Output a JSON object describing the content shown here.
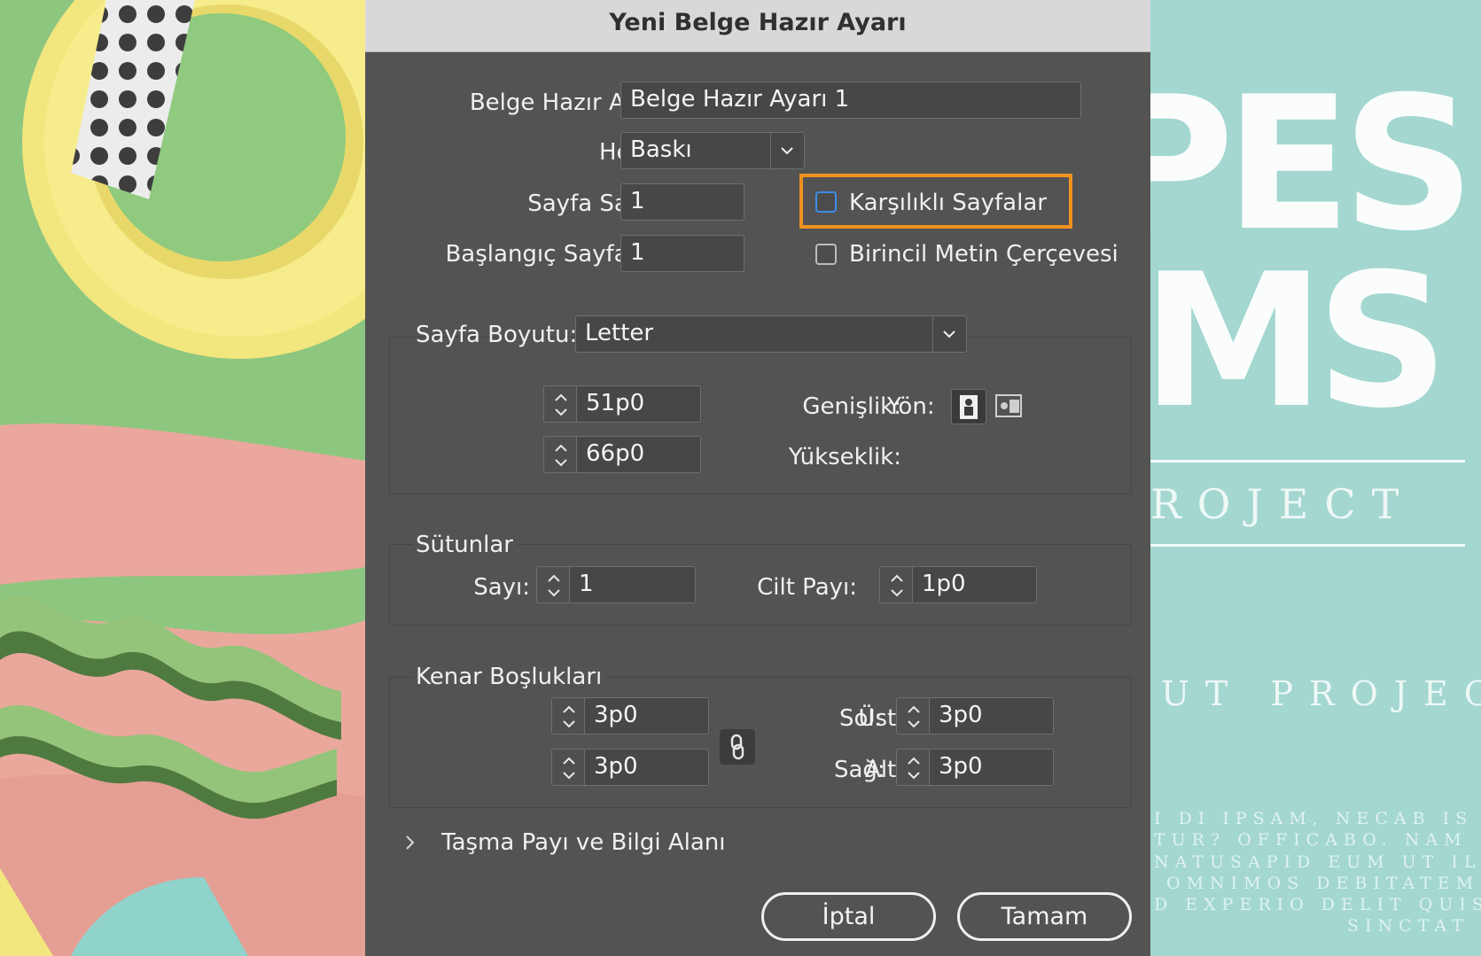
{
  "dialog": {
    "title": "Yeni Belge Hazır Ayarı",
    "preset": {
      "label": "Belge Hazır Ayarı:",
      "value": "Belge Hazır Ayarı 1"
    },
    "intent": {
      "label": "Hedef:",
      "value": "Baskı"
    },
    "page_count": {
      "label": "Sayfa Sayısı:",
      "value": "1"
    },
    "start_page": {
      "label": "Başlangıç Sayfa No:",
      "value": "1"
    },
    "facing_pages": {
      "label": "Karşılıklı Sayfalar",
      "checked": false,
      "highlighted": true
    },
    "primary_text_frame": {
      "label": "Birincil Metin Çerçevesi",
      "checked": false
    },
    "page_size": {
      "label": "Sayfa Boyutu:",
      "value": "Letter",
      "width": {
        "label": "Genişlik:",
        "value": "51p0"
      },
      "height": {
        "label": "Yükseklik:",
        "value": "66p0"
      },
      "orientation": {
        "label": "Yön:",
        "selected": "portrait",
        "options": [
          "portrait-icon",
          "landscape-icon"
        ]
      }
    },
    "columns": {
      "title": "Sütunlar",
      "number": {
        "label": "Sayı:",
        "value": "1"
      },
      "gutter": {
        "label": "Cilt Payı:",
        "value": "1p0"
      }
    },
    "margins": {
      "title": "Kenar Boşlukları",
      "top": {
        "label": "Üst:",
        "value": "3p0"
      },
      "bottom": {
        "label": "Alt:",
        "value": "3p0"
      },
      "left": {
        "label": "Sol:",
        "value": "3p0"
      },
      "right": {
        "label": "Sağ:",
        "value": "3p0"
      },
      "link_icon": "chain-link-icon"
    },
    "bleed_slug": {
      "label": "Taşma Payı ve Bilgi Alanı",
      "expanded": false
    },
    "buttons": {
      "cancel": "İptal",
      "ok": "Tamam"
    }
  },
  "background_right": {
    "big_line1": "PES",
    "big_line2": "MS",
    "subtitle1": "ROJECT",
    "subtitle2": "UT PROJECT",
    "body": [
      "I DI IPSAM, NECAB IS",
      "TUR? OFFICABO. NAM",
      "NATUSAPID EUM UT IL",
      "OMNIMOS DEBITATEM",
      "D EXPERIO DELIT QUIS",
      "SINCTAT"
    ]
  },
  "colors": {
    "focus_highlight": "#f0921e",
    "dialog_bg": "#535353",
    "titlebar_bg": "#d8d8d8",
    "checkbox_focus": "#3e8eea"
  }
}
